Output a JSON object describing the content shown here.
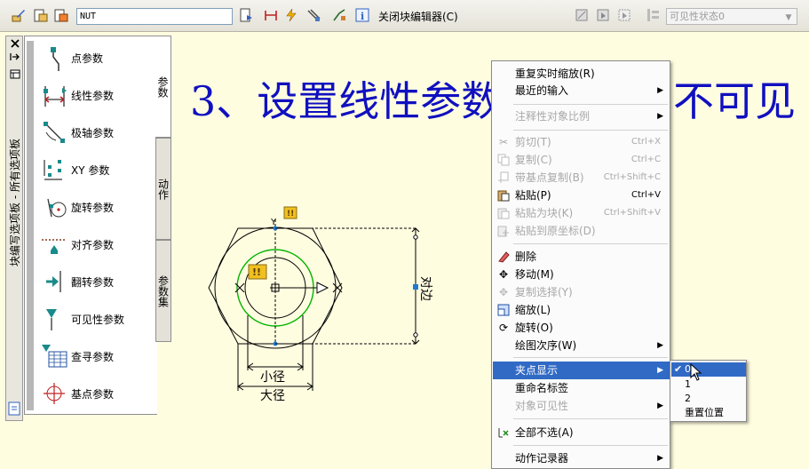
{
  "toolbar": {
    "block_name": "NUT",
    "close_label": "关闭块编辑器(C)",
    "visibility_state": "可见性状态0",
    "icons": [
      "edit-block-icon",
      "save-block-icon",
      "save-as-icon",
      "authoring-palettes-icon",
      "parameter-icon",
      "action-icon",
      "param-set-icon",
      "attribute-icon",
      "info-icon",
      "visibility-toggle-icon",
      "visibility-show-icon",
      "visibility-hide-icon",
      "manage-visibility-icon"
    ]
  },
  "palette": {
    "title": "块编写选项板 - 所有选项板",
    "tabs": [
      "参数",
      "动作",
      "参数集"
    ],
    "items": [
      {
        "label": "点参数"
      },
      {
        "label": "线性参数"
      },
      {
        "label": "极轴参数"
      },
      {
        "label": "XY 参数"
      },
      {
        "label": "旋转参数"
      },
      {
        "label": "对齐参数"
      },
      {
        "label": "翻转参数"
      },
      {
        "label": "可见性参数"
      },
      {
        "label": "查寻参数"
      },
      {
        "label": "基点参数"
      }
    ]
  },
  "heading": {
    "left": "3、设置线性参数的",
    "right": "不可见"
  },
  "drawing": {
    "label_small": "小径",
    "label_large": "大径",
    "label_side": "对边"
  },
  "context_menu": {
    "items": [
      {
        "label": "重复实时缩放(R)"
      },
      {
        "label": "最近的输入"
      },
      {
        "label": "注释性对象比例"
      },
      {
        "label": "剪切(T)",
        "shortcut": "Ctrl+X"
      },
      {
        "label": "复制(C)",
        "shortcut": "Ctrl+C"
      },
      {
        "label": "带基点复制(B)",
        "shortcut": "Ctrl+Shift+C"
      },
      {
        "label": "粘贴(P)",
        "shortcut": "Ctrl+V"
      },
      {
        "label": "粘贴为块(K)",
        "shortcut": "Ctrl+Shift+V"
      },
      {
        "label": "粘贴到原坐标(D)"
      },
      {
        "label": "删除"
      },
      {
        "label": "移动(M)"
      },
      {
        "label": "复制选择(Y)"
      },
      {
        "label": "缩放(L)"
      },
      {
        "label": "旋转(O)"
      },
      {
        "label": "绘图次序(W)"
      },
      {
        "label": "夹点显示"
      },
      {
        "label": "重命名标签"
      },
      {
        "label": "对象可见性"
      },
      {
        "label": "全部不选(A)"
      },
      {
        "label": "动作记录器"
      }
    ]
  },
  "grip_submenu": {
    "items": [
      "0",
      "1",
      "2",
      "重置位置"
    ]
  },
  "colors": {
    "heading": "#1010c0",
    "canvas": "#fffde0",
    "highlight": "#316ac5",
    "green_circle": "#00b400",
    "grip_blue": "#1e7ad2",
    "grip_yellow": "#f0c020"
  }
}
